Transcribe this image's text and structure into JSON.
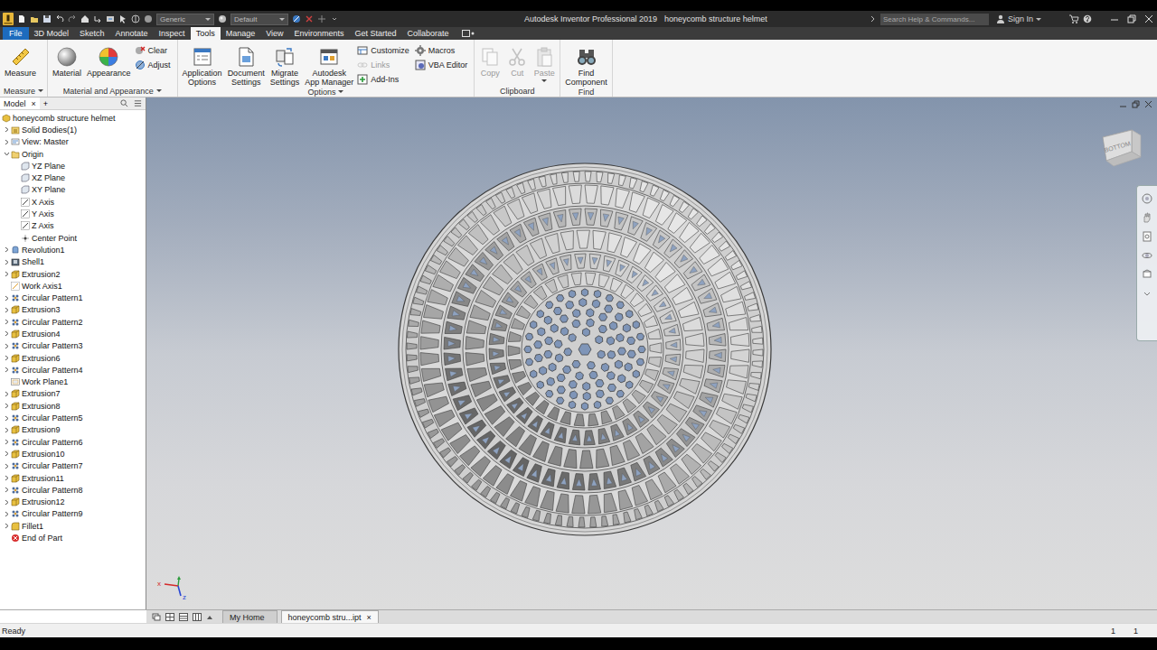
{
  "window": {
    "app_title": "Autodesk Inventor Professional 2019",
    "doc_title": "honeycomb structure helmet"
  },
  "quick_access": {
    "material": "Generic",
    "appearance": "Default"
  },
  "search": {
    "placeholder": "Search Help & Commands..."
  },
  "account": {
    "sign_in": "Sign In"
  },
  "ribbon_tabs": [
    {
      "label": "File",
      "kind": "app",
      "selected": false
    },
    {
      "label": "3D Model",
      "kind": "tab",
      "selected": false
    },
    {
      "label": "Sketch",
      "kind": "tab",
      "selected": false
    },
    {
      "label": "Annotate",
      "kind": "tab",
      "selected": false
    },
    {
      "label": "Inspect",
      "kind": "tab",
      "selected": false
    },
    {
      "label": "Tools",
      "kind": "tab",
      "selected": true
    },
    {
      "label": "Manage",
      "kind": "tab",
      "selected": false
    },
    {
      "label": "View",
      "kind": "tab",
      "selected": false
    },
    {
      "label": "Environments",
      "kind": "tab",
      "selected": false
    },
    {
      "label": "Get Started",
      "kind": "tab",
      "selected": false
    },
    {
      "label": "Collaborate",
      "kind": "tab",
      "selected": false
    }
  ],
  "ribbon_groups": [
    {
      "label": "Measure",
      "dropdown": true,
      "buttons": [
        {
          "kind": "large",
          "lines": [
            "Measure"
          ],
          "disabled": false,
          "dropdown": false
        }
      ]
    },
    {
      "label": "Material and Appearance",
      "dropdown": true,
      "buttons": [
        {
          "kind": "large",
          "lines": [
            "Material"
          ],
          "disabled": false,
          "dropdown": false
        },
        {
          "kind": "large",
          "lines": [
            "Appearance"
          ],
          "disabled": false,
          "dropdown": false
        },
        {
          "kind": "stack",
          "items": [
            {
              "label": "Clear",
              "disabled": false
            },
            {
              "label": "Adjust",
              "disabled": false
            }
          ]
        }
      ]
    },
    {
      "label": "Options",
      "dropdown": true,
      "buttons": [
        {
          "kind": "large",
          "lines": [
            "Application",
            "Options"
          ],
          "disabled": false,
          "dropdown": false
        },
        {
          "kind": "large",
          "lines": [
            "Document",
            "Settings"
          ],
          "disabled": false,
          "dropdown": false
        },
        {
          "kind": "large",
          "lines": [
            "Migrate",
            "Settings"
          ],
          "disabled": false,
          "dropdown": false
        },
        {
          "kind": "large",
          "lines": [
            "Autodesk",
            "App Manager"
          ],
          "disabled": false,
          "dropdown": false
        },
        {
          "kind": "stack",
          "items": [
            {
              "label": "Customize",
              "disabled": false
            },
            {
              "label": "Links",
              "disabled": true
            },
            {
              "label": "Add-Ins",
              "disabled": false
            }
          ]
        },
        {
          "kind": "stack",
          "items": [
            {
              "label": "Macros",
              "disabled": false
            },
            {
              "label": "VBA Editor",
              "disabled": false
            }
          ]
        }
      ]
    },
    {
      "label": "Clipboard",
      "dropdown": false,
      "buttons": [
        {
          "kind": "large",
          "lines": [
            "Copy"
          ],
          "disabled": true,
          "dropdown": false
        },
        {
          "kind": "large",
          "lines": [
            "Cut"
          ],
          "disabled": true,
          "dropdown": false
        },
        {
          "kind": "large",
          "lines": [
            "Paste"
          ],
          "disabled": true,
          "dropdown": true
        }
      ]
    },
    {
      "label": "Find",
      "dropdown": false,
      "buttons": [
        {
          "kind": "large",
          "lines": [
            "Find",
            "Component"
          ],
          "disabled": false,
          "dropdown": false
        }
      ]
    }
  ],
  "browser": {
    "tab": "Model",
    "close": "×",
    "add": "+",
    "root": {
      "label": "honeycomb structure helmet",
      "kind": "part"
    },
    "items": [
      {
        "label": "Solid Bodies(1)",
        "kind": "bodies",
        "expander": "collapsed"
      },
      {
        "label": "View: Master",
        "kind": "view",
        "expander": "collapsed"
      },
      {
        "label": "Origin",
        "kind": "origin",
        "expander": "expanded",
        "children": [
          {
            "label": "YZ Plane",
            "kind": "plane",
            "expander": "none"
          },
          {
            "label": "XZ Plane",
            "kind": "plane",
            "expander": "none"
          },
          {
            "label": "XY Plane",
            "kind": "plane",
            "expander": "none"
          },
          {
            "label": "X Axis",
            "kind": "axis",
            "expander": "none"
          },
          {
            "label": "Y Axis",
            "kind": "axis",
            "expander": "none"
          },
          {
            "label": "Z Axis",
            "kind": "axis",
            "expander": "none"
          },
          {
            "label": "Center Point",
            "kind": "point",
            "expander": "none"
          }
        ]
      },
      {
        "label": "Revolution1",
        "kind": "revolve",
        "expander": "collapsed"
      },
      {
        "label": "Shell1",
        "kind": "shell",
        "expander": "collapsed"
      },
      {
        "label": "Extrusion2",
        "kind": "extrude",
        "expander": "collapsed"
      },
      {
        "label": "Work Axis1",
        "kind": "workaxis",
        "expander": "none"
      },
      {
        "label": "Circular Pattern1",
        "kind": "pattern",
        "expander": "collapsed"
      },
      {
        "label": "Extrusion3",
        "kind": "extrude",
        "expander": "collapsed"
      },
      {
        "label": "Circular Pattern2",
        "kind": "pattern",
        "expander": "collapsed"
      },
      {
        "label": "Extrusion4",
        "kind": "extrude",
        "expander": "collapsed"
      },
      {
        "label": "Circular Pattern3",
        "kind": "pattern",
        "expander": "collapsed"
      },
      {
        "label": "Extrusion6",
        "kind": "extrude",
        "expander": "collapsed"
      },
      {
        "label": "Circular Pattern4",
        "kind": "pattern",
        "expander": "collapsed"
      },
      {
        "label": "Work Plane1",
        "kind": "workplane",
        "expander": "none"
      },
      {
        "label": "Extrusion7",
        "kind": "extrude",
        "expander": "collapsed"
      },
      {
        "label": "Extrusion8",
        "kind": "extrude",
        "expander": "collapsed"
      },
      {
        "label": "Circular Pattern5",
        "kind": "pattern",
        "expander": "collapsed"
      },
      {
        "label": "Extrusion9",
        "kind": "extrude",
        "expander": "collapsed"
      },
      {
        "label": "Circular Pattern6",
        "kind": "pattern",
        "expander": "collapsed"
      },
      {
        "label": "Extrusion10",
        "kind": "extrude",
        "expander": "collapsed"
      },
      {
        "label": "Circular Pattern7",
        "kind": "pattern",
        "expander": "collapsed"
      },
      {
        "label": "Extrusion11",
        "kind": "extrude",
        "expander": "collapsed"
      },
      {
        "label": "Circular Pattern8",
        "kind": "pattern",
        "expander": "collapsed"
      },
      {
        "label": "Extrusion12",
        "kind": "extrude",
        "expander": "collapsed"
      },
      {
        "label": "Circular Pattern9",
        "kind": "pattern",
        "expander": "collapsed"
      },
      {
        "label": "Fillet1",
        "kind": "fillet",
        "expander": "collapsed"
      },
      {
        "label": "End of Part",
        "kind": "end",
        "expander": "none"
      }
    ]
  },
  "viewport": {
    "viewcube": "BOTTOM",
    "triad": [
      {
        "label": "x",
        "color": "#d42a2a"
      },
      {
        "label": "z",
        "color": "#2a48d4"
      }
    ]
  },
  "doc_tabs": {
    "close": "×",
    "items": [
      {
        "label": "My Home",
        "selected": false,
        "closable": false
      },
      {
        "label": "honeycomb stru...ipt",
        "selected": true,
        "closable": true
      }
    ]
  },
  "status": {
    "text": "Ready",
    "counts": [
      "1",
      "1"
    ]
  }
}
